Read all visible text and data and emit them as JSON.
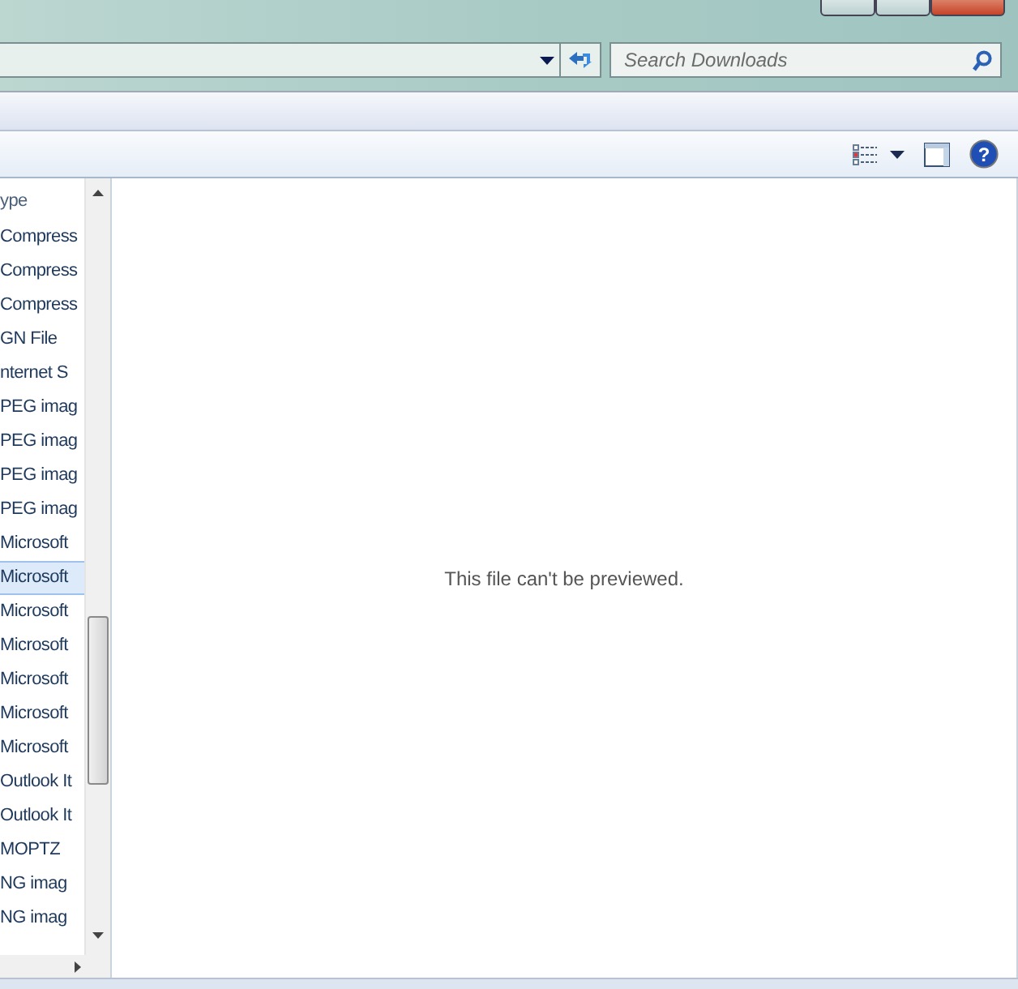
{
  "search": {
    "placeholder": "Search Downloads"
  },
  "file_list": {
    "column_header": "ype",
    "rows": [
      {
        "type": "Compress",
        "selected": false
      },
      {
        "type": "Compress",
        "selected": false
      },
      {
        "type": "Compress",
        "selected": false
      },
      {
        "type": "GN File",
        "selected": false
      },
      {
        "type": "nternet S",
        "selected": false
      },
      {
        "type": "PEG imag",
        "selected": false
      },
      {
        "type": "PEG imag",
        "selected": false
      },
      {
        "type": "PEG imag",
        "selected": false
      },
      {
        "type": "PEG imag",
        "selected": false
      },
      {
        "type": "Microsoft",
        "selected": false
      },
      {
        "type": "Microsoft",
        "selected": true
      },
      {
        "type": "Microsoft",
        "selected": false
      },
      {
        "type": "Microsoft",
        "selected": false
      },
      {
        "type": "Microsoft",
        "selected": false
      },
      {
        "type": "Microsoft",
        "selected": false
      },
      {
        "type": "Microsoft",
        "selected": false
      },
      {
        "type": "Outlook It",
        "selected": false
      },
      {
        "type": "Outlook It",
        "selected": false
      },
      {
        "type": "MOPTZ",
        "selected": false
      },
      {
        "type": "NG imag",
        "selected": false
      },
      {
        "type": "NG imag",
        "selected": false
      }
    ]
  },
  "preview": {
    "message": "This file can't be previewed."
  },
  "toolbar": {
    "help_glyph": "?"
  }
}
